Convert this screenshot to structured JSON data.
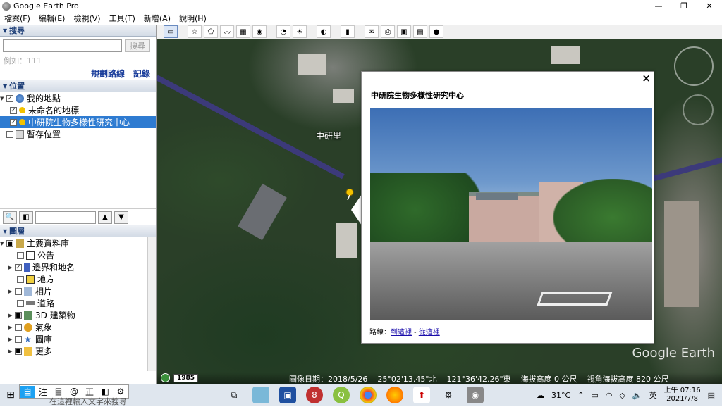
{
  "window": {
    "title": "Google Earth Pro",
    "minimize": "—",
    "maximize": "❐",
    "close": "✕"
  },
  "menu": [
    "檔案(F)",
    "編輯(E)",
    "檢視(V)",
    "工具(T)",
    "新增(A)",
    "說明(H)"
  ],
  "search": {
    "header": "搜尋",
    "placeholder": "",
    "button": "搜尋",
    "example": "例如：111",
    "links": [
      "規劃路線",
      "記錄"
    ]
  },
  "places": {
    "header": "位置",
    "items": [
      {
        "label": "我的地點",
        "checked": true,
        "level": 0
      },
      {
        "label": "未命名的地標",
        "checked": true,
        "level": 1
      },
      {
        "label": "中研院生物多樣性研究中心",
        "checked": true,
        "level": 1,
        "selected": true
      },
      {
        "label": "暫存位置",
        "checked": false,
        "level": 0
      }
    ]
  },
  "layers": {
    "header": "圖層",
    "items": [
      {
        "label": "主要資料庫",
        "level": 0
      },
      {
        "label": "公告",
        "level": 1
      },
      {
        "label": "邊界和地名",
        "level": 1,
        "checked": true
      },
      {
        "label": "地方",
        "level": 1
      },
      {
        "label": "相片",
        "level": 1
      },
      {
        "label": "道路",
        "level": 1
      },
      {
        "label": "3D 建築物",
        "level": 1
      },
      {
        "label": "氣象",
        "level": 1
      },
      {
        "label": "圖庫",
        "level": 1
      },
      {
        "label": "更多",
        "level": 1
      }
    ]
  },
  "map": {
    "place_label": "中研里",
    "logo": "Google Earth",
    "year": "1985",
    "status": {
      "date": "圖像日期：2018/5/26",
      "lat": "25°02'13.45\"北",
      "lon": "121°36'42.26\"東",
      "elev": "海拔高度    0 公尺",
      "eye": "視角海拔高度   820 公尺"
    }
  },
  "popup": {
    "title": "中研院生物多樣性研究中心",
    "close": "×",
    "route_prefix": "路線：",
    "route_to": "到這裡",
    "route_sep": " - ",
    "route_from": "從這裡"
  },
  "taskbar": {
    "ime": [
      "自",
      "注",
      "目",
      "@",
      "正",
      "◧",
      "⚙"
    ],
    "search_text": "在這裡輸入文字來搜尋",
    "weather": "31°C",
    "time": "上午 07:16",
    "date": "2021/7/8"
  }
}
